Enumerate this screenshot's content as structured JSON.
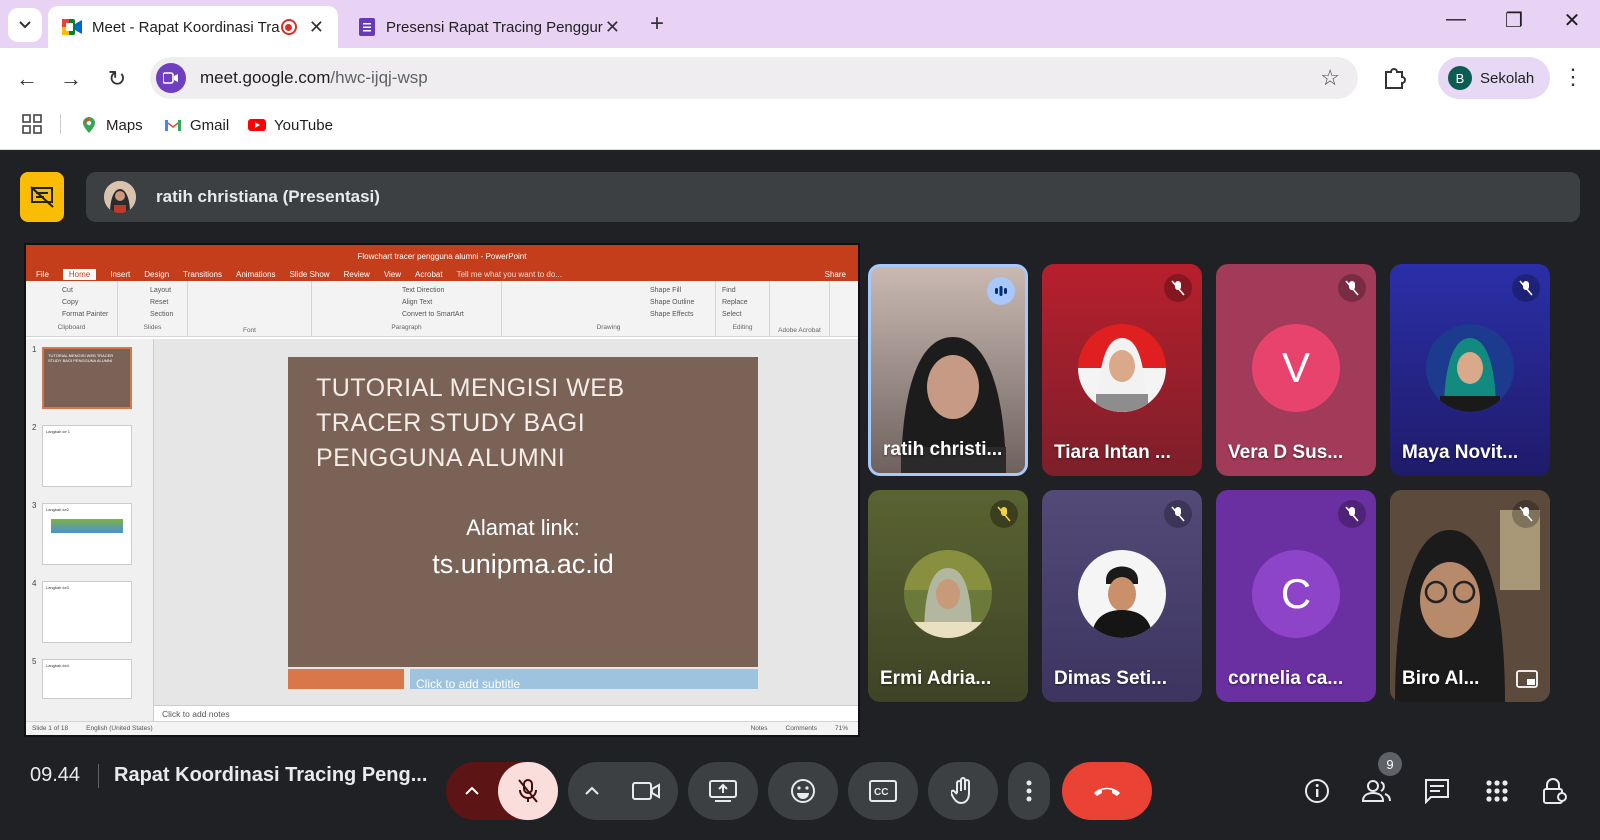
{
  "browser": {
    "tabs": [
      {
        "title": "Meet - Rapat Koordinasi Tra",
        "recording": true
      },
      {
        "title": "Presensi Rapat Tracing Penggur"
      }
    ],
    "url_host": "meet.google.com",
    "url_path": "/hwc-ijqj-wsp",
    "profile_initial": "B",
    "profile_name": "Sekolah",
    "bookmarks": [
      "Maps",
      "Gmail",
      "YouTube"
    ]
  },
  "meet": {
    "presenter_label": "ratih christiana (Presentasi)",
    "time": "09.44",
    "meeting_title": "Rapat Koordinasi Tracing Peng...",
    "participant_count": "9",
    "participants": [
      {
        "name": "ratih christi...",
        "status": "speaking"
      },
      {
        "name": "Tiara Intan ...",
        "status": "muted"
      },
      {
        "name": "Vera D Sus...",
        "status": "muted",
        "initial": "V",
        "color": "#e8436d"
      },
      {
        "name": "Maya Novit...",
        "status": "muted"
      },
      {
        "name": "Ermi Adria...",
        "status": "muted"
      },
      {
        "name": "Dimas Seti...",
        "status": "muted"
      },
      {
        "name": "cornelia ca...",
        "status": "muted",
        "initial": "C",
        "color": "#8e44c8"
      },
      {
        "name": "Biro Al...",
        "status": "muted"
      }
    ]
  },
  "ppt": {
    "window_title": "Flowchart tracer pengguna alumni - PowerPoint",
    "menu": [
      "File",
      "Home",
      "Insert",
      "Design",
      "Transitions",
      "Animations",
      "Slide Show",
      "Review",
      "View",
      "Acrobat"
    ],
    "tell_me": "Tell me what you want to do...",
    "share": "Share",
    "ribbon_groups": [
      "Clipboard",
      "Slides",
      "Font",
      "Paragraph",
      "Drawing",
      "Editing",
      "Adobe Acrobat"
    ],
    "clipboard_items": [
      "Cut",
      "Copy",
      "Format Painter"
    ],
    "slides_items": [
      "Layout",
      "Reset",
      "Section"
    ],
    "paragraph_items": [
      "Text Direction",
      "Align Text",
      "Convert to SmartArt"
    ],
    "drawing_items": [
      "Shape Fill",
      "Shape Outline",
      "Shape Effects"
    ],
    "editing_items": [
      "Find",
      "Replace",
      "Select"
    ],
    "slide_heading": "TUTORIAL MENGISI WEB TRACER STUDY BAGI PENGGUNA ALUMNI",
    "slide_line1": "Alamat link:",
    "slide_line2": "ts.unipma.ac.id",
    "subtitle_placeholder": "Click to add subtitle",
    "notes_placeholder": "Click to add notes",
    "status_slide": "Slide 1 of 18",
    "status_lang": "English (United States)",
    "status_notes": "Notes",
    "status_comments": "Comments",
    "zoom": "71%",
    "thumbnails": [
      {
        "num": "1",
        "caption": "TUTORIAL MENGISI WEB TRACER STUDY BAGI PENGGUNA ALUMNI"
      },
      {
        "num": "2",
        "caption": "Langkah ke 1"
      },
      {
        "num": "3",
        "caption": "Langkah ke2"
      },
      {
        "num": "4",
        "caption": "Langkah ke3"
      },
      {
        "num": "5",
        "caption": "Langkah ke4"
      }
    ]
  }
}
